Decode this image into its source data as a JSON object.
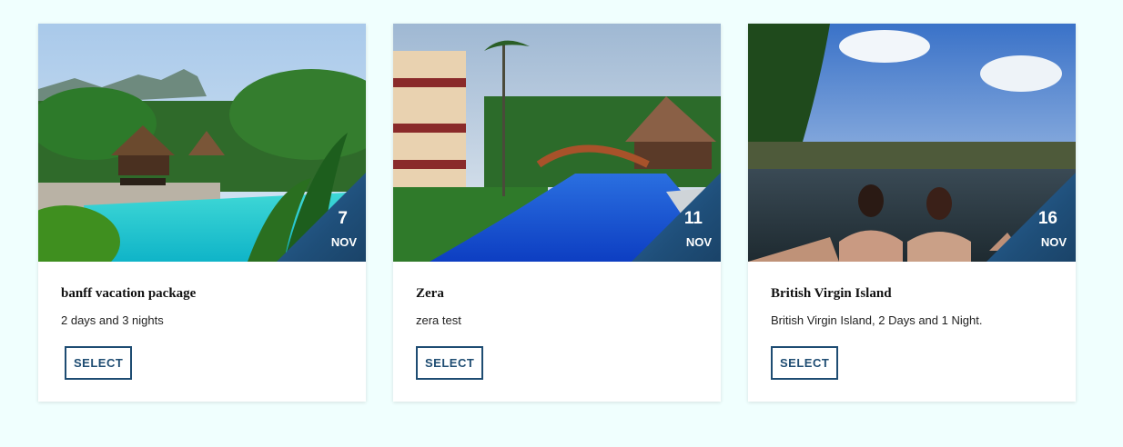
{
  "cards": [
    {
      "title": "banff vacation package",
      "description": "2 days and 3 nights",
      "day": "7",
      "month": "NOV",
      "button_label": "SELECT",
      "image": "tropical-resort-pool"
    },
    {
      "title": "Zera",
      "description": "zera test",
      "day": "11",
      "month": "NOV",
      "button_label": "SELECT",
      "image": "resort-pool-with-bridge"
    },
    {
      "title": "British Virgin Island",
      "description": "British Virgin Island, 2 Days and 1 Night.",
      "day": "16",
      "month": "NOV",
      "button_label": "SELECT",
      "image": "infinity-pool-two-people"
    }
  ]
}
